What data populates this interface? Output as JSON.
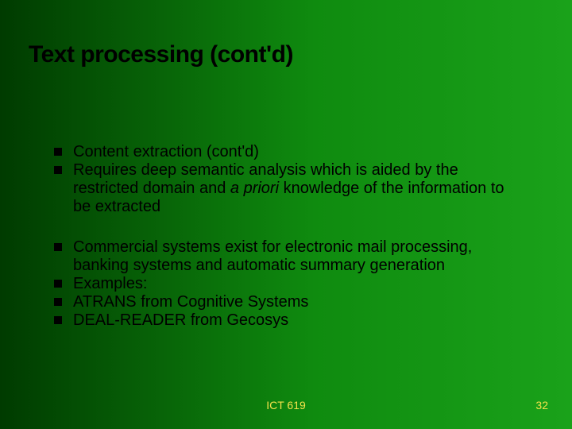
{
  "title": "Text processing (cont'd)",
  "group1": {
    "b0": "Content extraction (cont'd)",
    "b1_pre": "Requires deep semantic analysis which is aided by the restricted domain and ",
    "b1_em": "a priori",
    "b1_post": " knowledge of the information to be extracted"
  },
  "group2": {
    "b0": "Commercial systems exist for electronic mail processing, banking systems and automatic summary generation",
    "b1": "Examples:",
    "b2": "ATRANS from Cognitive Systems",
    "b3": "DEAL-READER from Gecosys"
  },
  "footer": {
    "center": "ICT 619",
    "right": "32"
  }
}
